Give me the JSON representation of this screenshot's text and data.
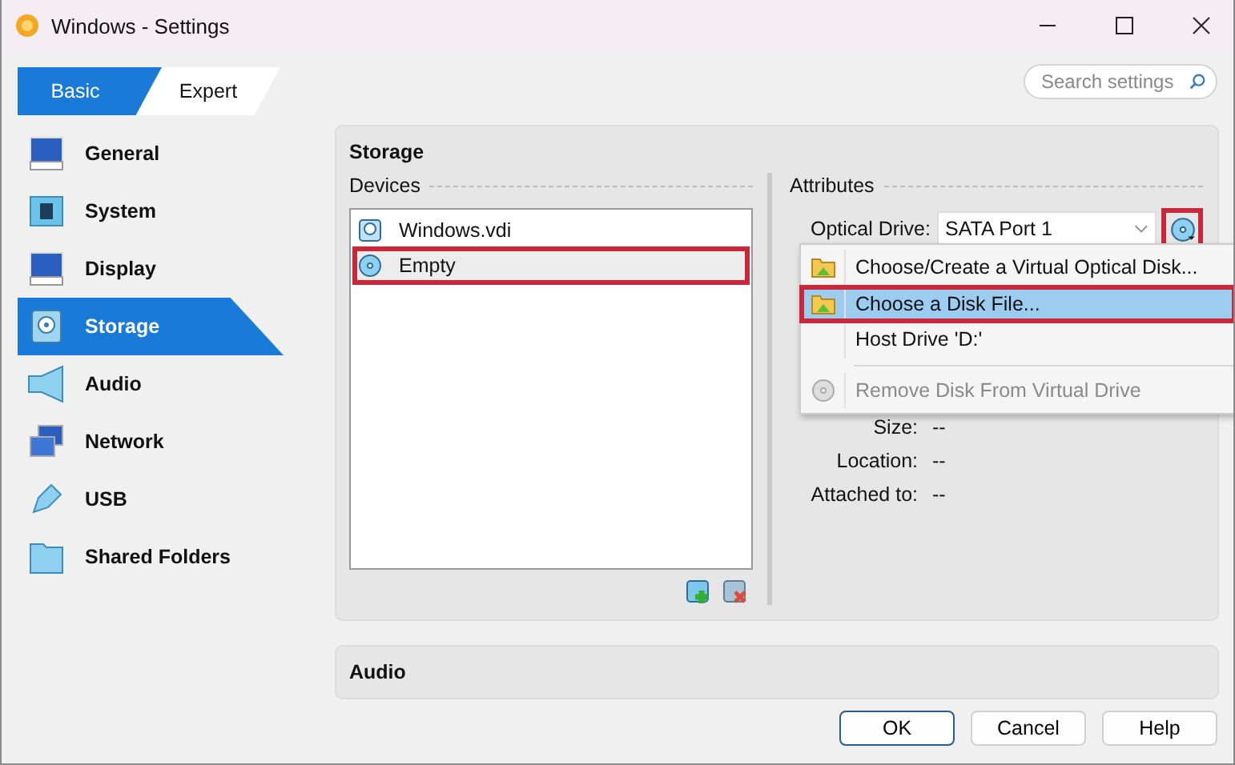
{
  "window": {
    "title": "Windows - Settings"
  },
  "mode_tabs": [
    {
      "label": "Basic",
      "selected": true
    },
    {
      "label": "Expert",
      "selected": false
    }
  ],
  "search": {
    "placeholder": "Search settings"
  },
  "sidebar": {
    "items": [
      {
        "label": "General",
        "selected": false
      },
      {
        "label": "System",
        "selected": false
      },
      {
        "label": "Display",
        "selected": false
      },
      {
        "label": "Storage",
        "selected": true
      },
      {
        "label": "Audio",
        "selected": false
      },
      {
        "label": "Network",
        "selected": false
      },
      {
        "label": "USB",
        "selected": false
      },
      {
        "label": "Shared Folders",
        "selected": false
      }
    ]
  },
  "storage": {
    "title": "Storage",
    "devices": {
      "label": "Devices",
      "items": [
        {
          "name": "Windows.vdi",
          "kind": "hard-disk",
          "selected": false,
          "highlighted": false
        },
        {
          "name": "Empty",
          "kind": "optical",
          "selected": true,
          "highlighted": true
        }
      ]
    },
    "attributes": {
      "label": "Attributes",
      "optical_drive": {
        "label": "Optical Drive:",
        "value": "SATA Port 1",
        "button_highlighted": true
      },
      "size": {
        "label": "Size:",
        "value": "--"
      },
      "location": {
        "label": "Location:",
        "value": "--"
      },
      "attached_to": {
        "label": "Attached to:",
        "value": "--"
      }
    }
  },
  "disk_menu": {
    "items": [
      {
        "label": "Choose/Create a Virtual Optical Disk...",
        "kind": "folder",
        "selected": false,
        "highlighted": false,
        "disabled": false
      },
      {
        "label": "Choose a Disk File...",
        "kind": "folder",
        "selected": true,
        "highlighted": true,
        "disabled": false
      },
      {
        "label": "Host Drive 'D:'",
        "kind": "plain",
        "selected": false,
        "highlighted": false,
        "disabled": false
      },
      {
        "kind": "separator"
      },
      {
        "label": "Remove Disk From Virtual Drive",
        "kind": "disc",
        "selected": false,
        "highlighted": false,
        "disabled": true
      }
    ]
  },
  "audio": {
    "title": "Audio"
  },
  "buttons": [
    {
      "label": "OK",
      "default": true
    },
    {
      "label": "Cancel",
      "default": false
    },
    {
      "label": "Help",
      "default": false
    }
  ]
}
